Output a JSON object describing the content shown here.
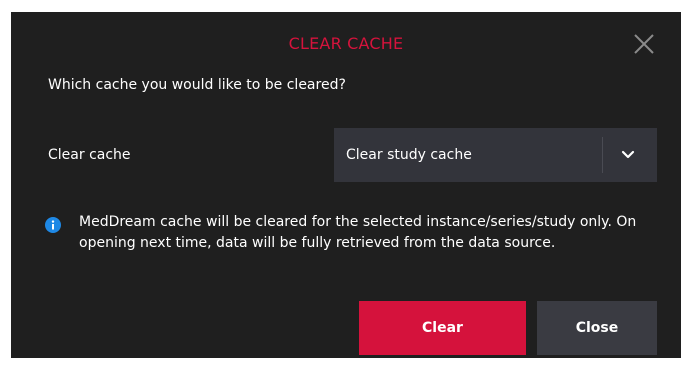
{
  "dialog": {
    "title": "CLEAR CACHE",
    "question": "Which cache you would like to be cleared?",
    "field_label": "Clear cache",
    "select": {
      "selected": "Clear study cache"
    },
    "info_text": "MedDream cache will be cleared for the selected instance/series/study only. On opening next time, data will be fully retrieved from the data source.",
    "buttons": {
      "clear_label": "Clear",
      "close_label": "Close"
    }
  },
  "icons": {
    "close": "close-icon",
    "dropdown": "chevron-down-icon",
    "info": "info-icon"
  },
  "colors": {
    "dialog_background": "#1f1f1f",
    "title_accent": "#d5133c",
    "primary_button": "#d5123c",
    "secondary_button": "#3a3b42",
    "select_background": "#33343b",
    "info_icon": "#1e88e5"
  }
}
